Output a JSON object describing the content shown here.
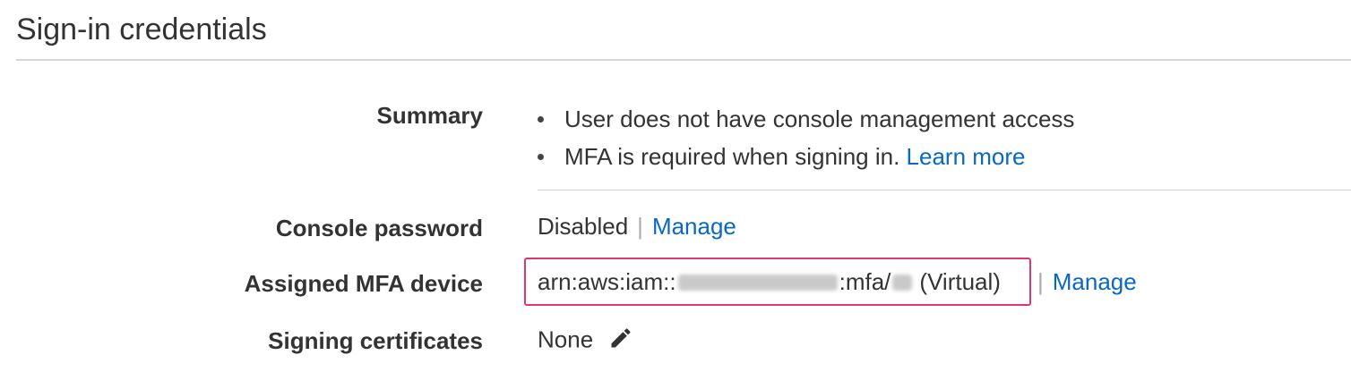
{
  "section": {
    "title": "Sign-in credentials"
  },
  "rows": {
    "summary": {
      "label": "Summary",
      "items": [
        {
          "text": "User does not have console management access"
        },
        {
          "text": "MFA is required when signing in.",
          "link": "Learn more"
        }
      ]
    },
    "console_password": {
      "label": "Console password",
      "status": "Disabled",
      "separator": "|",
      "link": "Manage"
    },
    "mfa_device": {
      "label": "Assigned MFA device",
      "arn_prefix": "arn:aws:iam::",
      "arn_mid": ":mfa/",
      "suffix": "(Virtual)",
      "separator": "|",
      "link": "Manage"
    },
    "signing_certificates": {
      "label": "Signing certificates",
      "value": "None",
      "icon": "pencil-icon"
    }
  },
  "colors": {
    "link": "#0a68c2",
    "highlight_border": "#e0376f",
    "text": "#333333"
  }
}
